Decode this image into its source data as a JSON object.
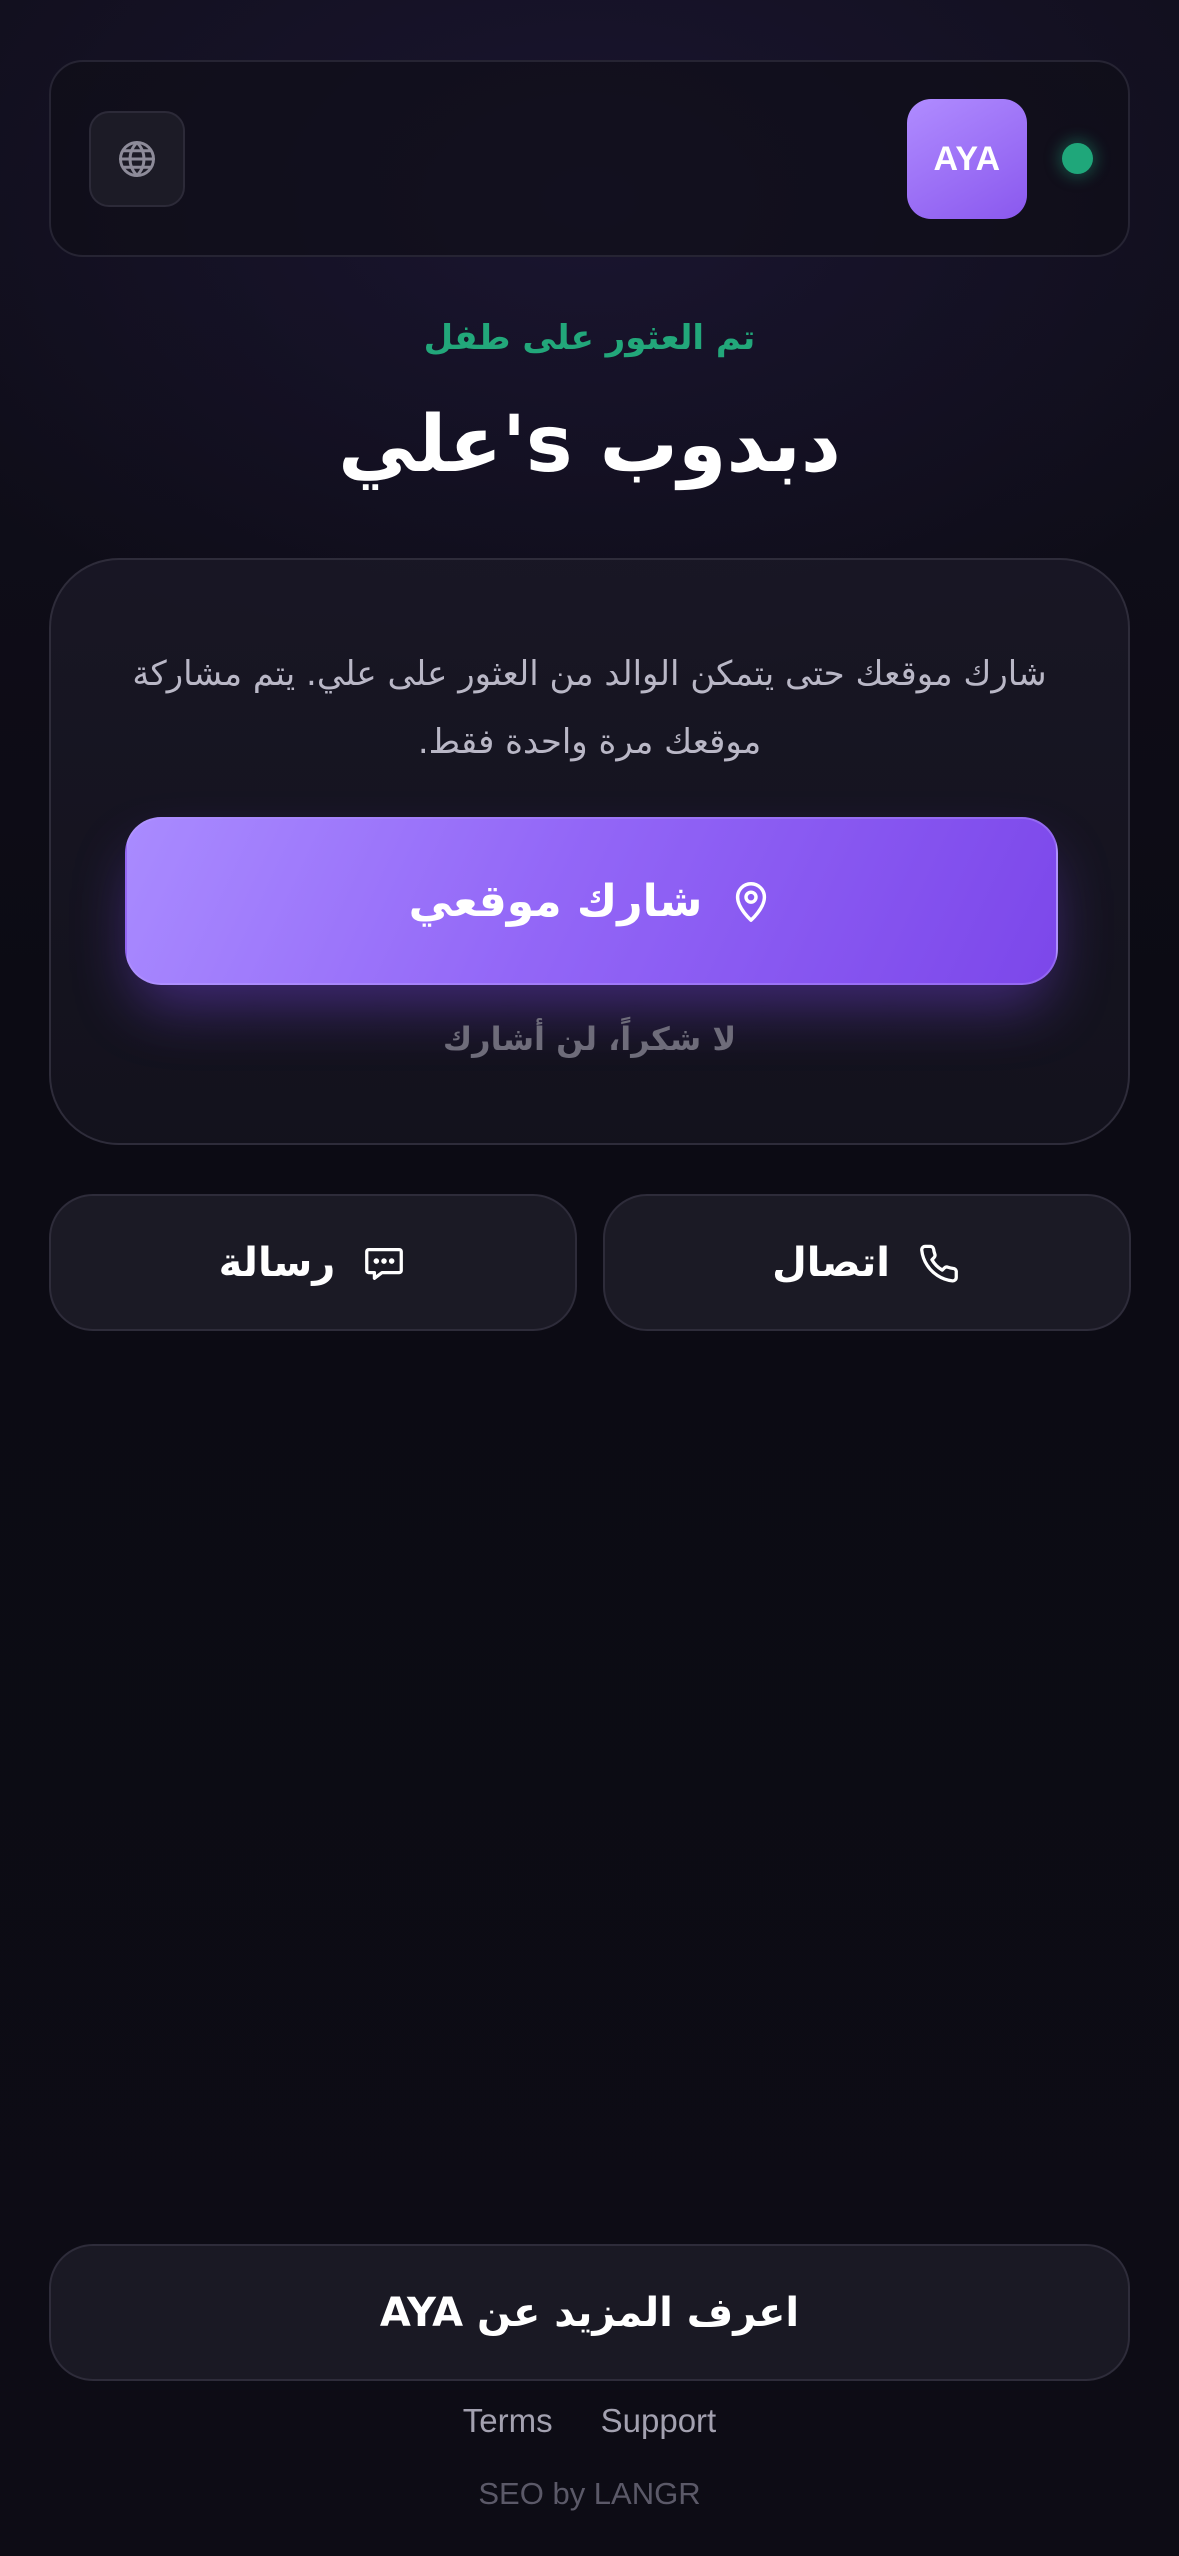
{
  "header": {
    "logo_text": "AYA",
    "status_color": "#1fa77a",
    "language_icon": "globe-icon"
  },
  "main": {
    "found_label": "تم العثور على طفل",
    "title": "علي's دبدوب",
    "card": {
      "message": "شارك موقعك حتى يتمكن الوالد من العثور على علي. يتم مشاركة موقعك مرة واحدة فقط.",
      "share_button_label": "شارك موقعي",
      "share_icon": "location-pin-icon",
      "decline_label": "لا شكراً، لن أشارك"
    },
    "actions": {
      "call_label": "اتصال",
      "call_icon": "phone-icon",
      "message_label": "رسالة",
      "message_icon": "chat-bubble-icon"
    }
  },
  "footer": {
    "learn_more_label": "اعرف المزيد عن AYA",
    "links": [
      "Terms",
      "Support"
    ],
    "credit": "SEO by LANGR"
  },
  "colors": {
    "accent": "#8a58ee",
    "success": "#1fa77a",
    "background": "#0c0b14"
  }
}
